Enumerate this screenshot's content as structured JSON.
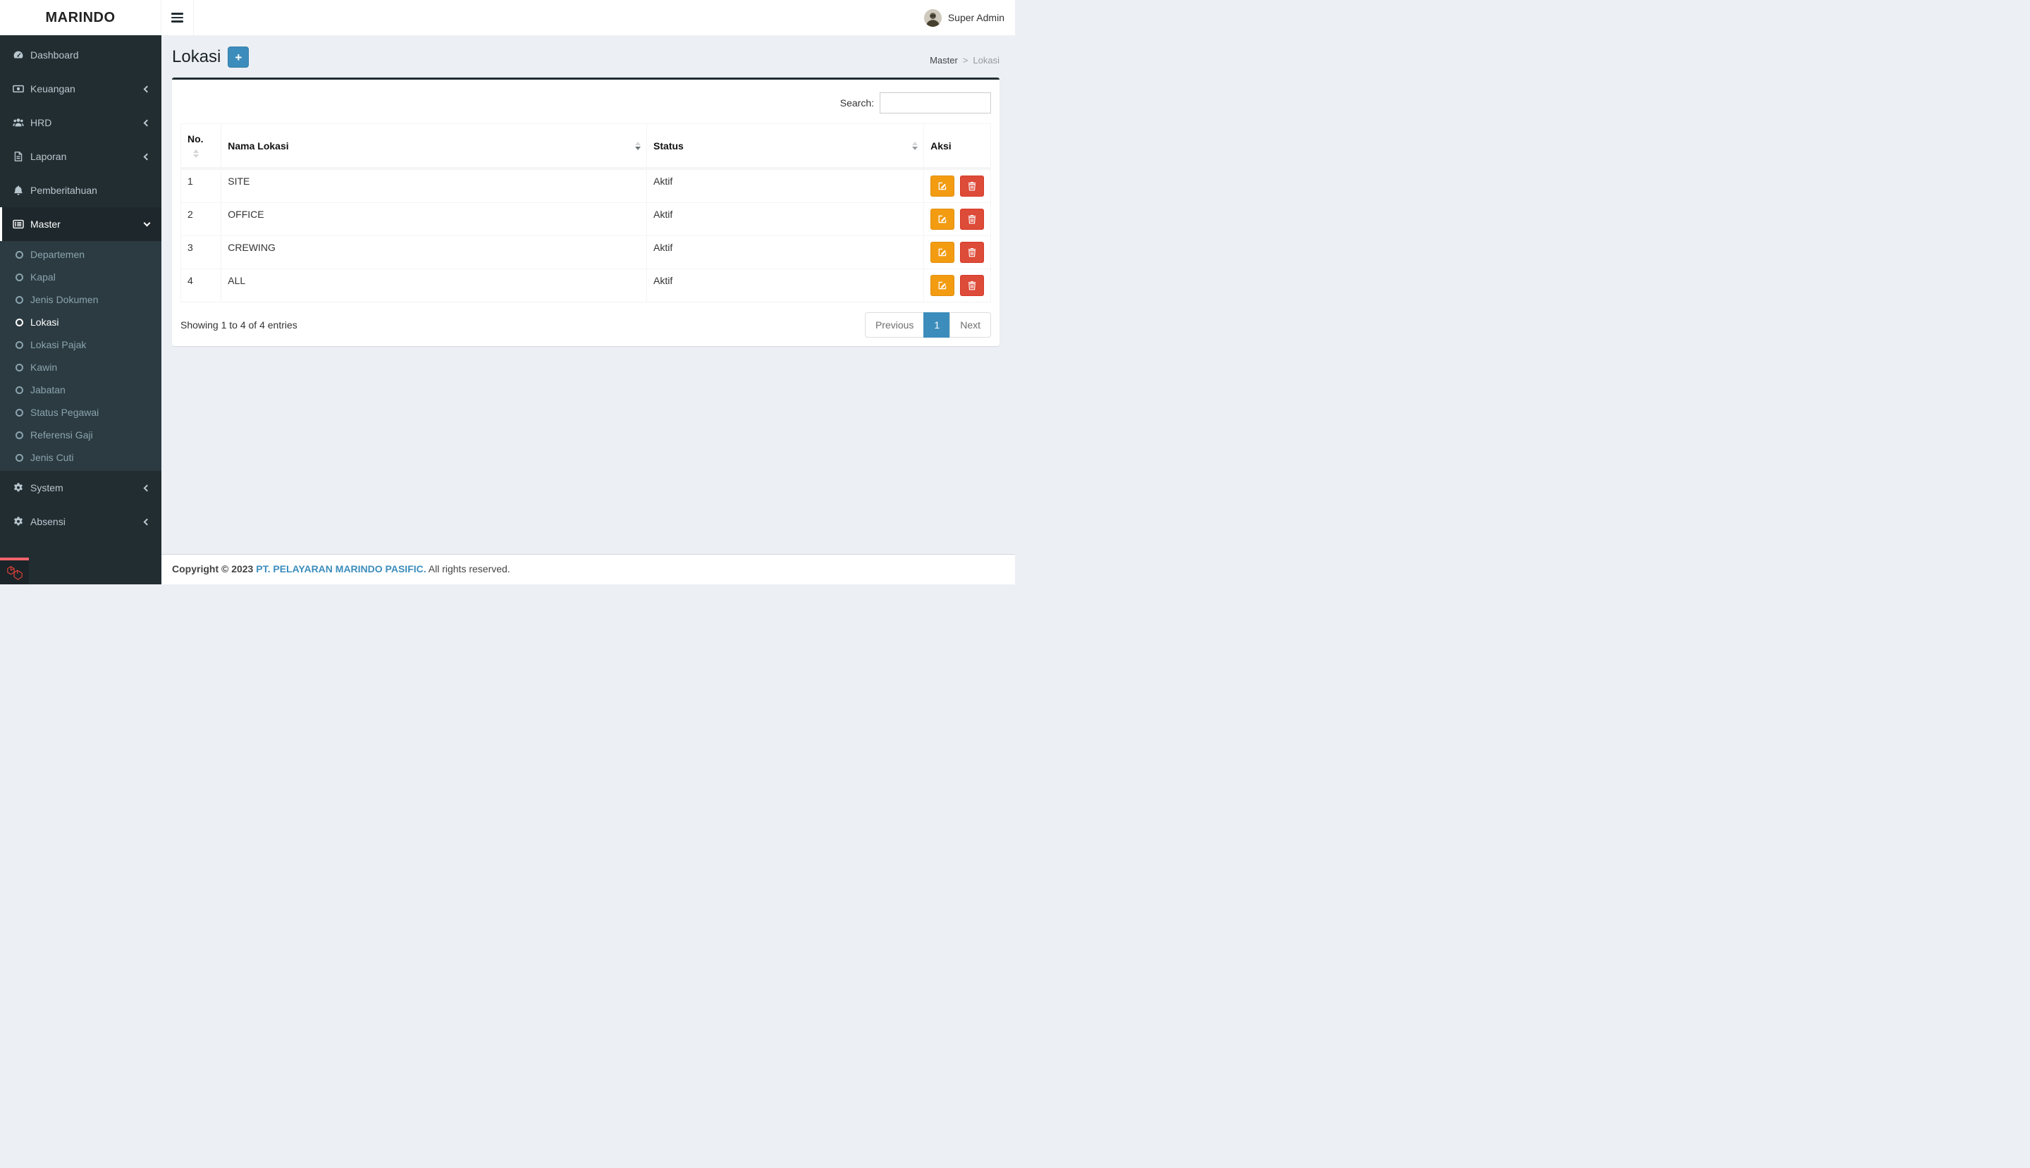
{
  "brand": {
    "name": "MARINDO"
  },
  "topbar": {
    "user": "Super Admin"
  },
  "sidebar": {
    "items": {
      "dashboard": "Dashboard",
      "keuangan": "Keuangan",
      "hrd": "HRD",
      "laporan": "Laporan",
      "pemberitahuan": "Pemberitahuan",
      "master": "Master",
      "system": "System",
      "absensi": "Absensi"
    },
    "submenu": [
      "Departemen",
      "Kapal",
      "Jenis Dokumen",
      "Lokasi",
      "Lokasi Pajak",
      "Kawin",
      "Jabatan",
      "Status Pegawai",
      "Referensi Gaji",
      "Jenis Cuti"
    ],
    "active_item": "Master",
    "active_submenu": "Lokasi"
  },
  "page": {
    "title": "Lokasi",
    "add_button_label": "+",
    "breadcrumb": {
      "parent": "Master",
      "separator": ">",
      "current": "Lokasi"
    }
  },
  "panel": {
    "search_label": "Search:",
    "search_value": "",
    "table": {
      "columns": [
        "No.",
        "Nama Lokasi",
        "Status",
        "Aksi"
      ],
      "rows": [
        {
          "no": "1",
          "nama": "SITE",
          "status": "Aktif"
        },
        {
          "no": "2",
          "nama": "OFFICE",
          "status": "Aktif"
        },
        {
          "no": "3",
          "nama": "CREWING",
          "status": "Aktif"
        },
        {
          "no": "4",
          "nama": "ALL",
          "status": "Aktif"
        }
      ]
    },
    "info": "Showing 1 to 4 of 4 entries",
    "pagination": {
      "previous": "Previous",
      "current_page": "1",
      "next": "Next"
    }
  },
  "footer": {
    "copyright": "Copyright © 2023",
    "company": "PT. PELAYARAN MARINDO PASIFIC.",
    "rights": "All rights reserved."
  },
  "colors": {
    "accent": "#3c8dbc",
    "sidebar_bg": "#222d32",
    "submenu_bg": "#2c3b41",
    "content_bg": "#ecf0f5",
    "edit_button": "#f39c12",
    "delete_button": "#dd4b39",
    "laravel_red": "#f4646c"
  }
}
